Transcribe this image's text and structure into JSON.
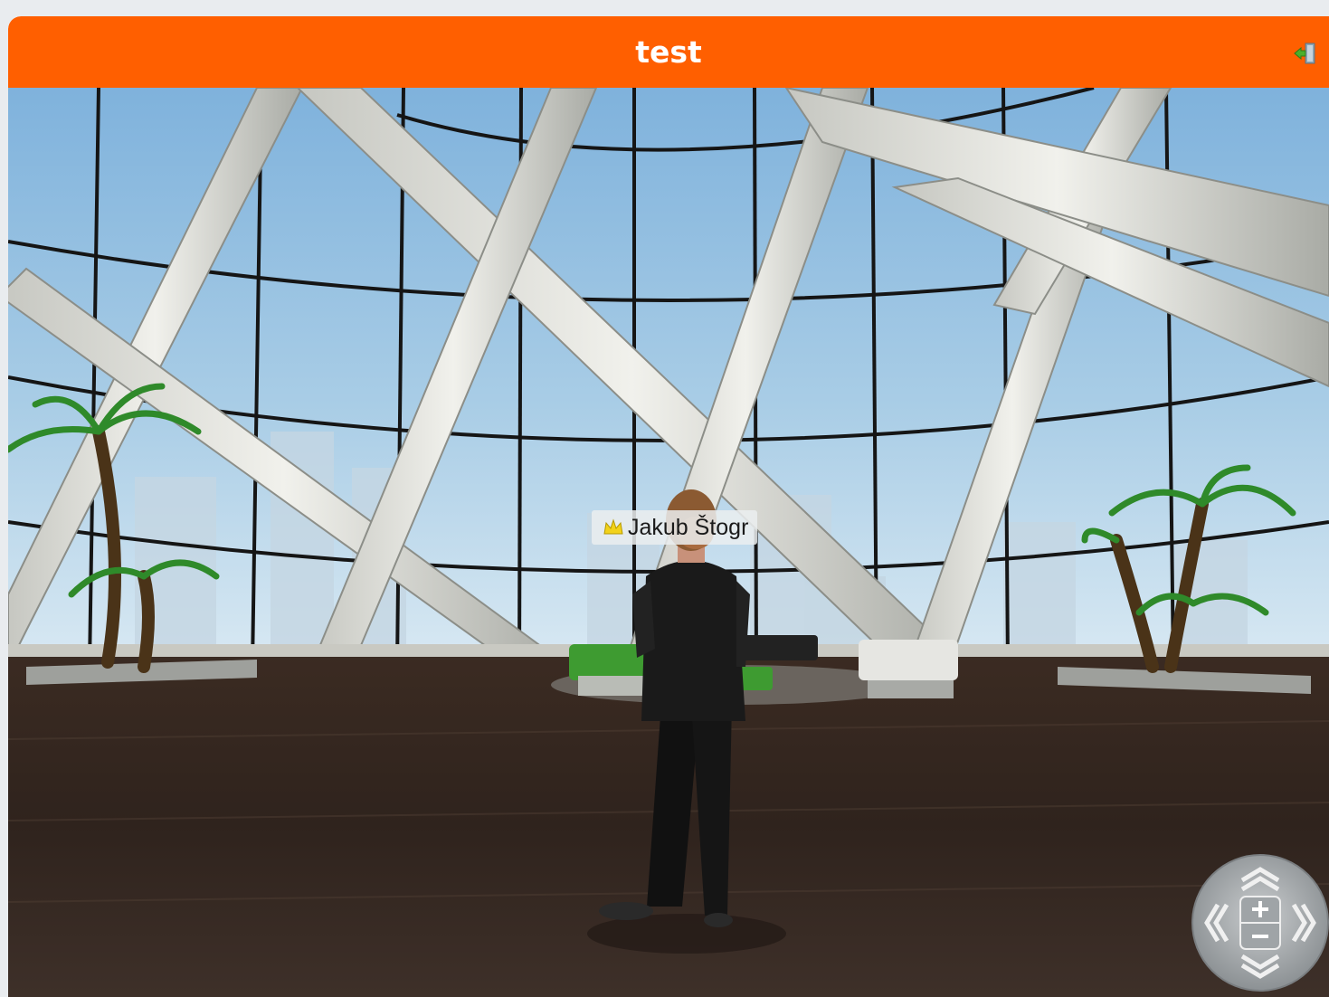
{
  "window": {
    "title": "test"
  },
  "avatar": {
    "name": "Jakub Štogr"
  },
  "icons": {
    "exit": "exit-door-icon",
    "crown": "crown-icon",
    "nav_up": "chevron-up-icon",
    "nav_down": "chevron-down-icon",
    "nav_left": "chevron-left-icon",
    "nav_right": "chevron-right-icon",
    "zoom_in": "plus-icon",
    "zoom_out": "minus-icon"
  },
  "colors": {
    "titlebar": "#ff5f00",
    "title_text": "#ffffff"
  }
}
